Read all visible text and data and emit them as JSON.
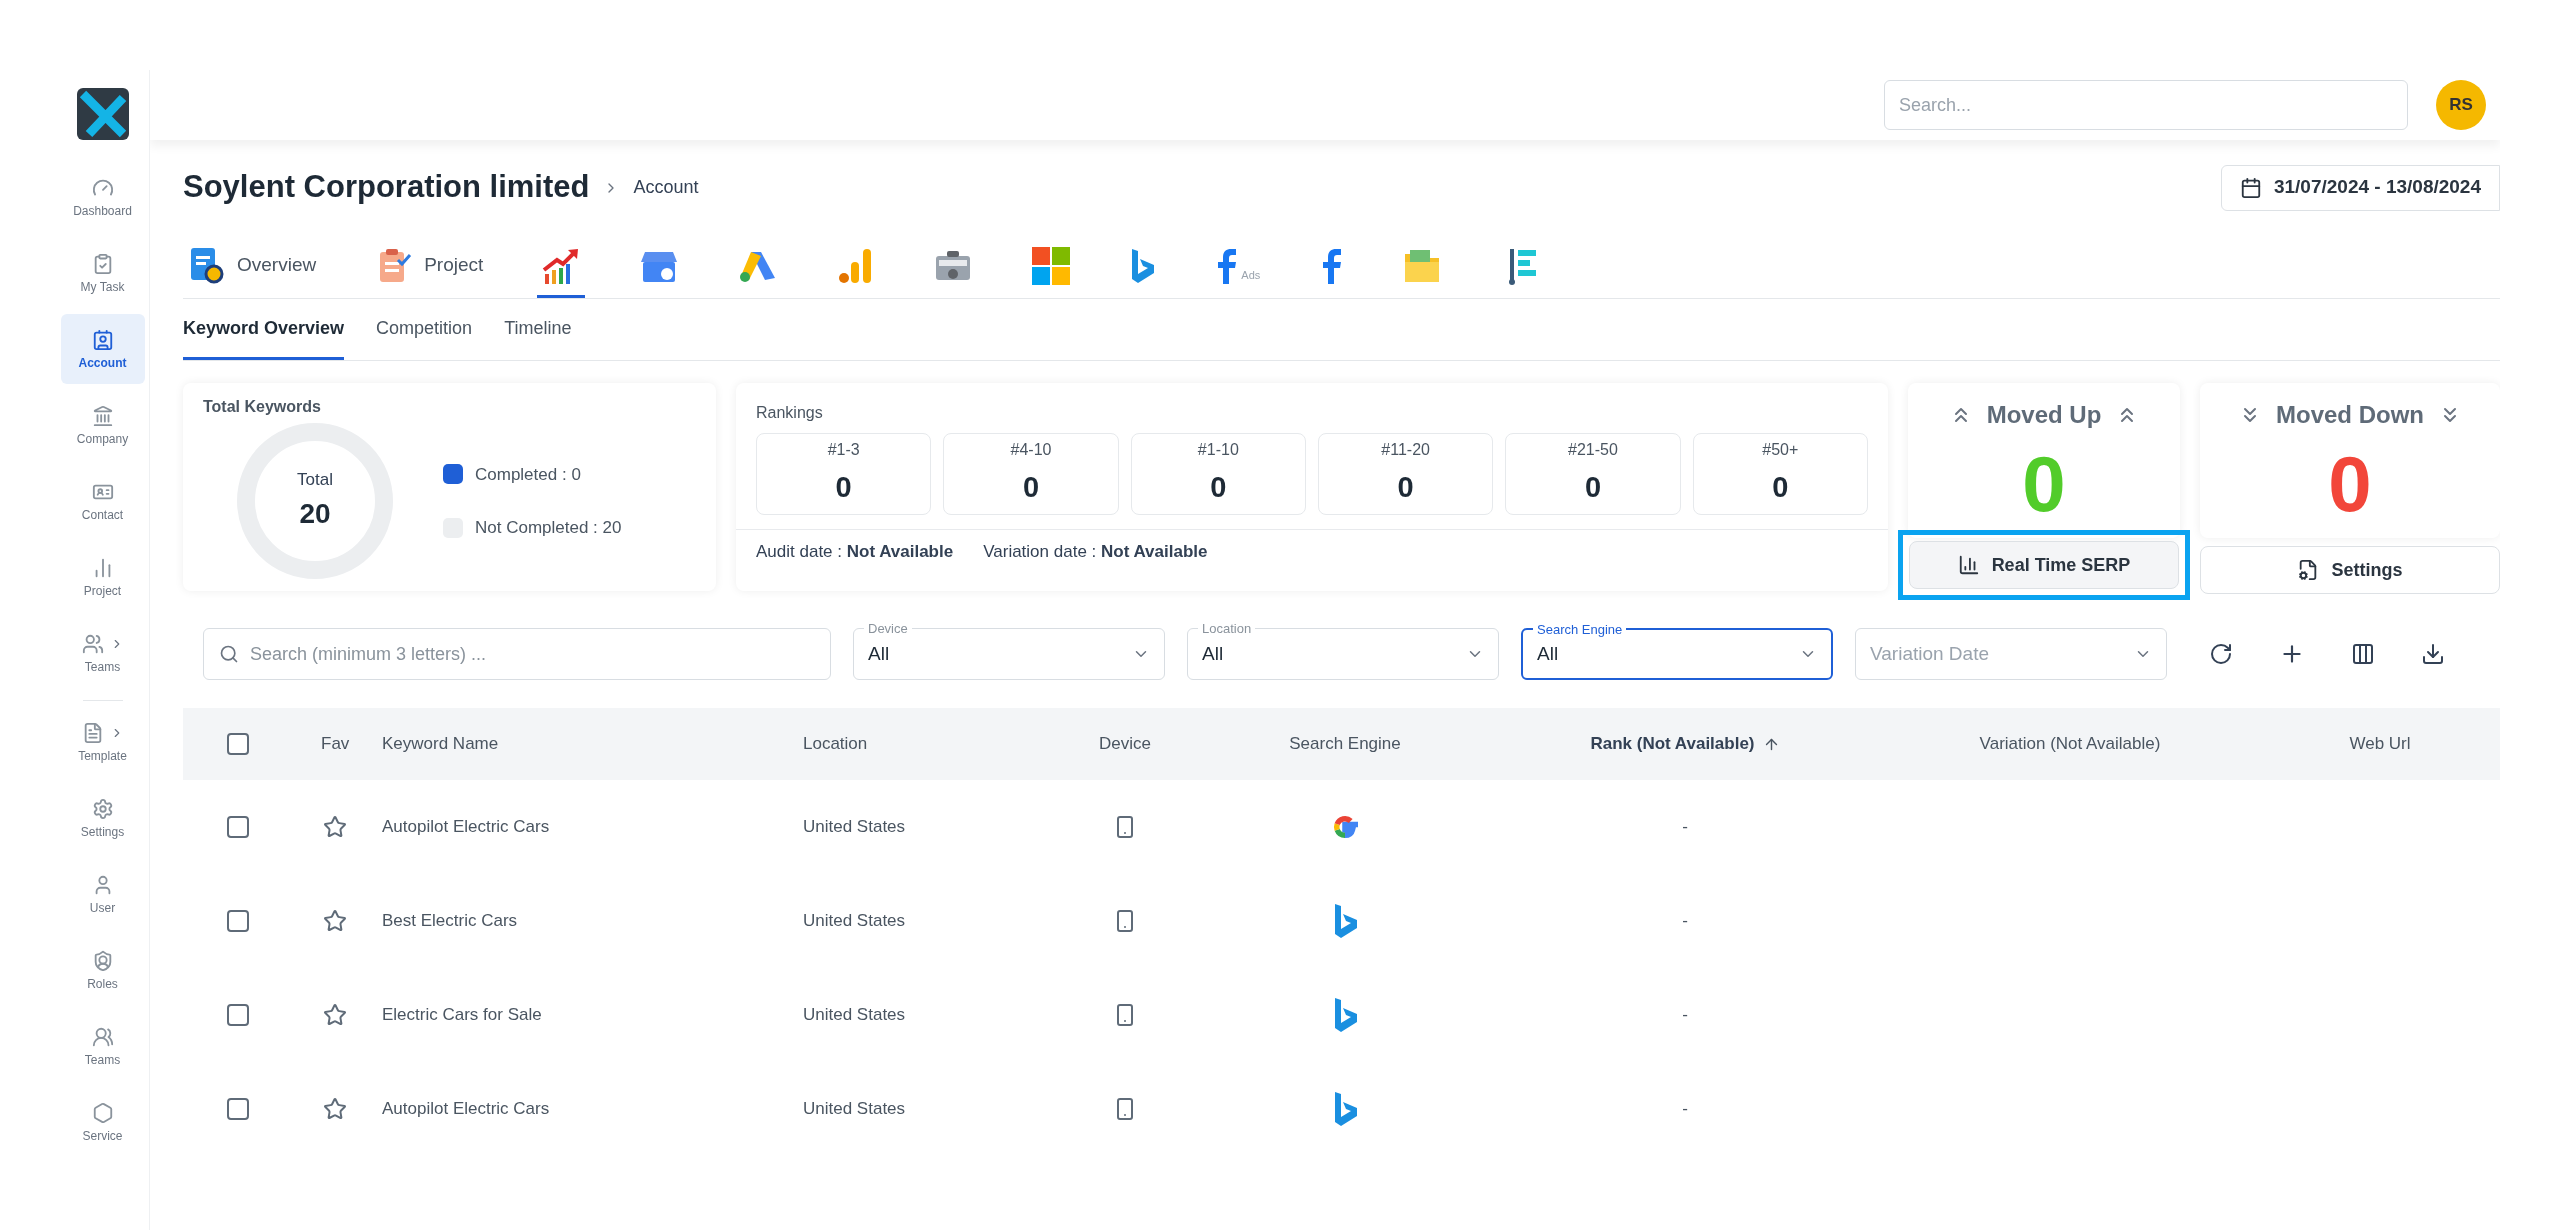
{
  "sidebar": {
    "items": [
      {
        "label": "Dashboard",
        "selected": false,
        "submenu": false
      },
      {
        "label": "My Task",
        "selected": false,
        "submenu": false
      },
      {
        "label": "Account",
        "selected": true,
        "submenu": false
      },
      {
        "label": "Company",
        "selected": false,
        "submenu": false
      },
      {
        "label": "Contact",
        "selected": false,
        "submenu": false
      },
      {
        "label": "Project",
        "selected": false,
        "submenu": false
      },
      {
        "label": "Teams",
        "selected": false,
        "submenu": true
      },
      {
        "label": "Template",
        "selected": false,
        "submenu": true
      },
      {
        "label": "Settings",
        "selected": false,
        "submenu": false
      },
      {
        "label": "User",
        "selected": false,
        "submenu": false
      },
      {
        "label": "Roles",
        "selected": false,
        "submenu": false
      },
      {
        "label": "Teams",
        "selected": false,
        "submenu": false
      },
      {
        "label": "Service",
        "selected": false,
        "submenu": false
      }
    ]
  },
  "header": {
    "search": {
      "placeholder": "Search..."
    },
    "avatar": "RS"
  },
  "page": {
    "title": "Soylent Corporation limited",
    "breadcrumb": "Account",
    "date_range": "31/07/2024 - 13/08/2024"
  },
  "platform_tabs": [
    {
      "label": "Overview",
      "selected": false
    },
    {
      "label": "Project",
      "selected": false
    },
    {
      "selected": true
    },
    {
      "selected": false
    },
    {
      "selected": false
    },
    {
      "selected": false
    },
    {
      "selected": false
    },
    {
      "selected": false
    },
    {
      "selected": false
    },
    {
      "caption": "Ads",
      "selected": false
    },
    {
      "selected": false
    },
    {
      "selected": false
    },
    {
      "selected": false
    }
  ],
  "sub_tabs": [
    {
      "label": "Keyword Overview",
      "selected": true
    },
    {
      "label": "Competition",
      "selected": false
    },
    {
      "label": "Timeline",
      "selected": false
    }
  ],
  "total_keywords": {
    "title": "Total Keywords",
    "center_label": "Total",
    "center_value": "20",
    "legend": [
      {
        "label": "Completed : 0",
        "color": "#1f5fd6"
      },
      {
        "label": "Not Completed : 20",
        "color": "#eceef0"
      }
    ]
  },
  "rankings": {
    "title": "Rankings",
    "boxes": [
      {
        "label": "#1-3",
        "value": "0"
      },
      {
        "label": "#4-10",
        "value": "0"
      },
      {
        "label": "#1-10",
        "value": "0"
      },
      {
        "label": "#11-20",
        "value": "0"
      },
      {
        "label": "#21-50",
        "value": "0"
      },
      {
        "label": "#50+",
        "value": "0"
      }
    ],
    "audit_label": "Audit date :",
    "audit_value": "Not Available",
    "variation_label": "Variation date :",
    "variation_value": "Not Available"
  },
  "movement": [
    {
      "kind": "up",
      "title": "Moved Up",
      "value": "0",
      "button": "Real Time SERP",
      "highlighted": true
    },
    {
      "kind": "down",
      "title": "Moved Down",
      "value": "0",
      "button": "Settings",
      "highlighted": false
    }
  ],
  "filters": {
    "search": {
      "placeholder": "Search (minimum 3 letters) ..."
    },
    "selects": [
      {
        "label": "Device",
        "value": "All",
        "focused": false
      },
      {
        "label": "Location",
        "value": "All",
        "focused": false
      },
      {
        "label": "Search Engine",
        "value": "All",
        "focused": true
      },
      {
        "placeholder": "Variation Date",
        "focused": false
      }
    ]
  },
  "table": {
    "columns": [
      "Fav",
      "Keyword Name",
      "Location",
      "Device",
      "Search Engine",
      "Rank (Not Available)",
      "Variation (Not Available)",
      "Web Url"
    ],
    "all_checked": false,
    "rows": [
      {
        "checked": false,
        "fav": false,
        "keyword": "Autopilot Electric Cars",
        "location": "United States",
        "kind": "google",
        "rank": "-"
      },
      {
        "checked": false,
        "fav": false,
        "keyword": "Best Electric Cars",
        "location": "United States",
        "kind": "bing",
        "rank": "-"
      },
      {
        "checked": false,
        "fav": false,
        "keyword": "Electric Cars for Sale",
        "location": "United States",
        "kind": "bing",
        "rank": "-"
      },
      {
        "checked": false,
        "fav": false,
        "keyword": "Autopilot Electric Cars",
        "location": "United States",
        "kind": "bing",
        "rank": "-"
      }
    ]
  }
}
